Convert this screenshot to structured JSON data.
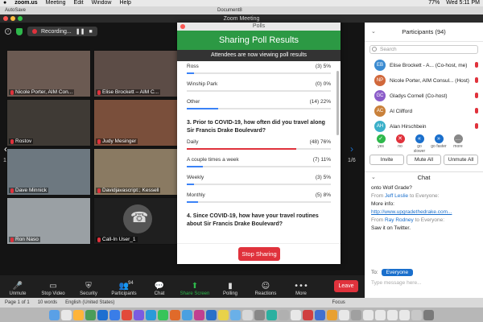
{
  "menubar": {
    "app": "zoom.us",
    "items": [
      "Meeting",
      "Edit",
      "Window",
      "Help"
    ],
    "battery": "77%",
    "clock": "Wed 5:11 PM"
  },
  "doc_window": {
    "autosave": "AutoSave",
    "title": "Document8"
  },
  "zoom_window": {
    "title": "Zoom Meeting",
    "recording_label": "Recording..."
  },
  "video_tiles": [
    {
      "name": "Nicole Porter, AIM Con...",
      "bg": "#6b5a52"
    },
    {
      "name": "Elise Brockett – AIM C...",
      "bg": "#5c4c46"
    },
    {
      "name": "Rostov",
      "bg": "#3f3a35"
    },
    {
      "name": "Judy Mesinger",
      "bg": "#7a4f3b"
    },
    {
      "name": "Dave Minnick",
      "bg": "#6d7880"
    },
    {
      "name": "Davidjavascript:; Kessell",
      "bg": "#8a7a62"
    },
    {
      "name": "Ron Naso",
      "bg": "#9aa0a4"
    },
    {
      "name": "Call-In User_1",
      "bg": "#1f1f1f"
    }
  ],
  "gallery_page": "1/6",
  "poll": {
    "window_title": "Polls",
    "header": "Sharing Poll Results",
    "subheader": "Attendees are now viewing poll results",
    "stop_button": "Stop Sharing",
    "pre_options": [
      {
        "label": "Ross",
        "result": "(3) 5%",
        "pct": 5
      },
      {
        "label": "Winship Park",
        "result": "(0) 0%",
        "pct": 0
      },
      {
        "label": "Other",
        "result": "(14) 22%",
        "pct": 22
      }
    ],
    "q3": {
      "text": "3. Prior to COVID-19, how often did you travel along Sir Francis Drake Boulevard?",
      "options": [
        {
          "label": "Daily",
          "result": "(48) 76%",
          "pct": 76
        },
        {
          "label": "A couple times a week",
          "result": "(7) 11%",
          "pct": 11
        },
        {
          "label": "Weekly",
          "result": "(3) 5%",
          "pct": 5
        },
        {
          "label": "Monthly",
          "result": "(5) 8%",
          "pct": 8
        }
      ]
    },
    "q4": {
      "text": "4. Since COVID-19, how have your travel routines about Sir Francis Drake Boulevard?"
    }
  },
  "participants": {
    "header": "Participants (94)",
    "search_placeholder": "Search",
    "list": [
      {
        "initials": "EB",
        "name": "Elise Brockett - A... (Co-host, me)",
        "color": "#3b8bd1"
      },
      {
        "initials": "NP",
        "name": "Nicole Porter, AIM Consul... (Host)",
        "color": "#d1683b"
      },
      {
        "initials": "GC",
        "name": "Gladys Cornell (Co-host)",
        "color": "#8b5cc9"
      },
      {
        "initials": "AC",
        "name": "Al Clifford",
        "color": "#c9813b"
      },
      {
        "initials": "AH",
        "name": "Alan Hirschbein",
        "color": "#3bb0c9"
      }
    ],
    "reactions": [
      {
        "label": "yes",
        "glyph": "✓",
        "color": "#2eb84b"
      },
      {
        "label": "no",
        "glyph": "✕",
        "color": "#e0323c"
      },
      {
        "label": "go slower",
        "glyph": "«",
        "color": "#1a6fcc"
      },
      {
        "label": "go faster",
        "glyph": "»",
        "color": "#1a6fcc"
      },
      {
        "label": "more",
        "glyph": "…",
        "color": "#888888"
      }
    ],
    "buttons": {
      "invite": "Invite",
      "mute_all": "Mute All",
      "unmute_all": "Unmute All"
    }
  },
  "chat": {
    "header": "Chat",
    "messages": [
      {
        "from": "",
        "text": "onto Wolf Grade?"
      },
      {
        "from": "Jeff Leslie",
        "prefix": "From ",
        "suffix": " to Everyone:",
        "text": "More info: ",
        "link": "http://www.upgradethedrake.com..."
      },
      {
        "from": "Ray Rodney",
        "prefix": "From ",
        "suffix": " to Everyone:",
        "text": "Saw it on Twitter."
      }
    ],
    "to_label": "To:",
    "to_value": "Everyone",
    "input_placeholder": "Type message here..."
  },
  "toolbar": {
    "items": [
      {
        "label": "Unmute",
        "glyph": "🎤"
      },
      {
        "label": "Stop Video",
        "glyph": "▭"
      },
      {
        "label": "Security",
        "glyph": "⛨"
      },
      {
        "label": "Participants",
        "glyph": "👥",
        "badge": "94"
      },
      {
        "label": "Chat",
        "glyph": "💬"
      },
      {
        "label": "Share Screen",
        "glyph": "⬆"
      },
      {
        "label": "Polling",
        "glyph": "▮"
      },
      {
        "label": "Reactions",
        "glyph": "☺"
      },
      {
        "label": "More",
        "glyph": "•••"
      }
    ],
    "leave": "Leave"
  },
  "word_status": {
    "page": "Page 1 of 1",
    "words": "10 words",
    "language": "English (United States)",
    "focus": "Focus"
  },
  "colors": {
    "poll_green": "#2c9944",
    "bar_blue": "#3b82f6",
    "bar_red": "#e0323c",
    "leave_red": "#e0323c"
  }
}
